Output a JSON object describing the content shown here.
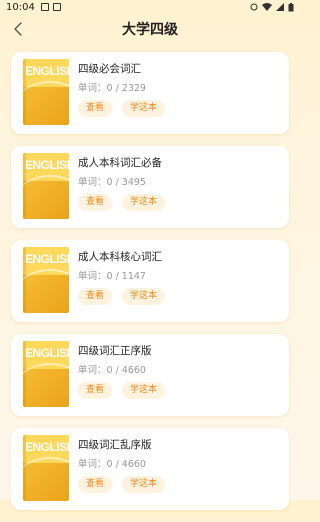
{
  "status_bar": {
    "time": "10:04",
    "icons": [
      "image-icon",
      "download-icon",
      "circle-icon",
      "wifi-icon",
      "signal-icon",
      "battery-icon"
    ]
  },
  "header": {
    "title": "大学四级",
    "back_icon": "chevron-left-icon"
  },
  "book_cover_text": "ENGLISH",
  "count_label": "单词：",
  "view_label": "查看",
  "learn_label": "学这本",
  "books": [
    {
      "title": "四级必会词汇",
      "count": "0 / 2329"
    },
    {
      "title": "成人本科词汇必备",
      "count": "0 / 3495"
    },
    {
      "title": "成人本科核心词汇",
      "count": "0 / 1147"
    },
    {
      "title": "四级词汇正序版",
      "count": "0 / 4660"
    },
    {
      "title": "四级词汇乱序版",
      "count": "0 / 4660"
    }
  ],
  "colors": {
    "accent": "#ef8a1b",
    "button_bg": "#fff2df",
    "cover": "#f1b22a"
  }
}
